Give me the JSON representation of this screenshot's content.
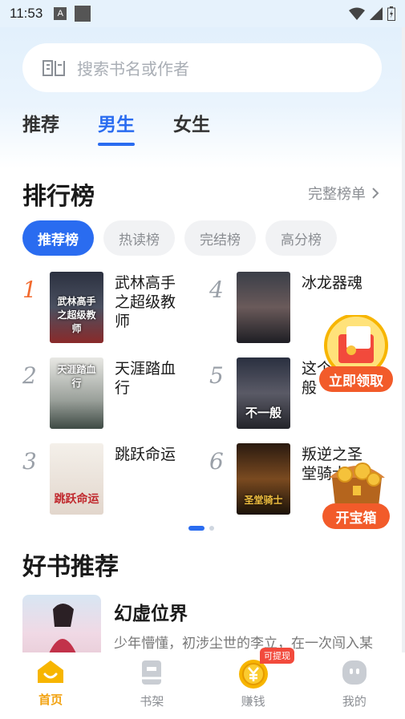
{
  "status": {
    "time": "11:53",
    "a_icon": "A"
  },
  "search": {
    "placeholder": "搜索书名或作者"
  },
  "tabs": [
    {
      "label": "推荐"
    },
    {
      "label": "男生"
    },
    {
      "label": "女生"
    }
  ],
  "ranking": {
    "title": "排行榜",
    "more": "完整榜单",
    "chips": [
      {
        "label": "推荐榜"
      },
      {
        "label": "热读榜"
      },
      {
        "label": "完结榜"
      },
      {
        "label": "高分榜"
      }
    ],
    "items": [
      {
        "rank": "1",
        "name": "武林高手之超级教师",
        "cover_text": "武林高手之超级教师"
      },
      {
        "rank": "2",
        "name": "天涯踏血行",
        "cover_text": "天涯踏血行"
      },
      {
        "rank": "3",
        "name": "跳跃命运",
        "cover_text": "跳跃命运"
      },
      {
        "rank": "4",
        "name": "冰龙器魂",
        "cover_text": ""
      },
      {
        "rank": "5",
        "name": "这个不一般",
        "cover_text": "不一般"
      },
      {
        "rank": "6",
        "name": "叛逆之圣堂骑士",
        "cover_text": "圣堂骑士"
      }
    ]
  },
  "recommend": {
    "title": "好书推荐",
    "book_title": "幻虚位界",
    "book_desc": "少年懵懂，初涉尘世的李立，在一次闯入某宗门山门……"
  },
  "floats": {
    "red_packet": "立即领取",
    "chest": "开宝箱"
  },
  "nav": {
    "items": [
      {
        "label": "首页"
      },
      {
        "label": "书架"
      },
      {
        "label": "赚钱"
      },
      {
        "label": "我的"
      }
    ],
    "badge": "可提现"
  },
  "colors": {
    "accent": "#2a6cf0",
    "orange": "#f2a312",
    "rank_first": "#f26a2e"
  }
}
